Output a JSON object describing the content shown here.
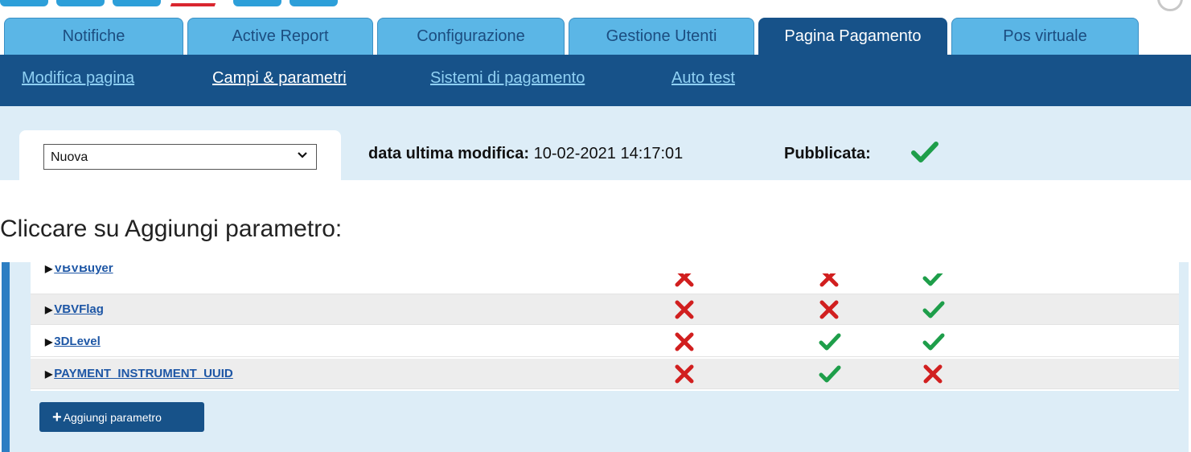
{
  "tabs": [
    {
      "label": "Notifiche",
      "active": false
    },
    {
      "label": "Active Report",
      "active": false
    },
    {
      "label": "Configurazione",
      "active": false
    },
    {
      "label": "Gestione Utenti",
      "active": false
    },
    {
      "label": "Pagina Pagamento",
      "active": true
    },
    {
      "label": "Pos virtuale",
      "active": false
    }
  ],
  "subnav": [
    {
      "label": "Modifica pagina",
      "current": false
    },
    {
      "label": "Campi & parametri",
      "current": true
    },
    {
      "label": "Sistemi di pagamento",
      "current": false
    },
    {
      "label": "Auto test",
      "current": false
    }
  ],
  "header": {
    "select_value": "Nuova",
    "last_modified_label": "data ultima modifica:",
    "last_modified_value": "10-02-2021 14:17:01",
    "published_label": "Pubblicata:",
    "published": true
  },
  "instruction": "Cliccare su Aggiungi parametro:",
  "parameters": [
    {
      "name": "VBVBuyer",
      "c1": false,
      "c2": false,
      "c3": true
    },
    {
      "name": "VBVFlag",
      "c1": false,
      "c2": false,
      "c3": true
    },
    {
      "name": "3DLevel",
      "c1": false,
      "c2": true,
      "c3": true
    },
    {
      "name": "PAYMENT_INSTRUMENT_UUID",
      "c1": false,
      "c2": true,
      "c3": false
    }
  ],
  "add_button": {
    "label": "Aggiungi parametro"
  },
  "colors": {
    "primary": "#175289",
    "tab": "#5bb6e6",
    "check": "#1e9e4a",
    "cross": "#d11f1f",
    "panel": "#ddedf7"
  }
}
